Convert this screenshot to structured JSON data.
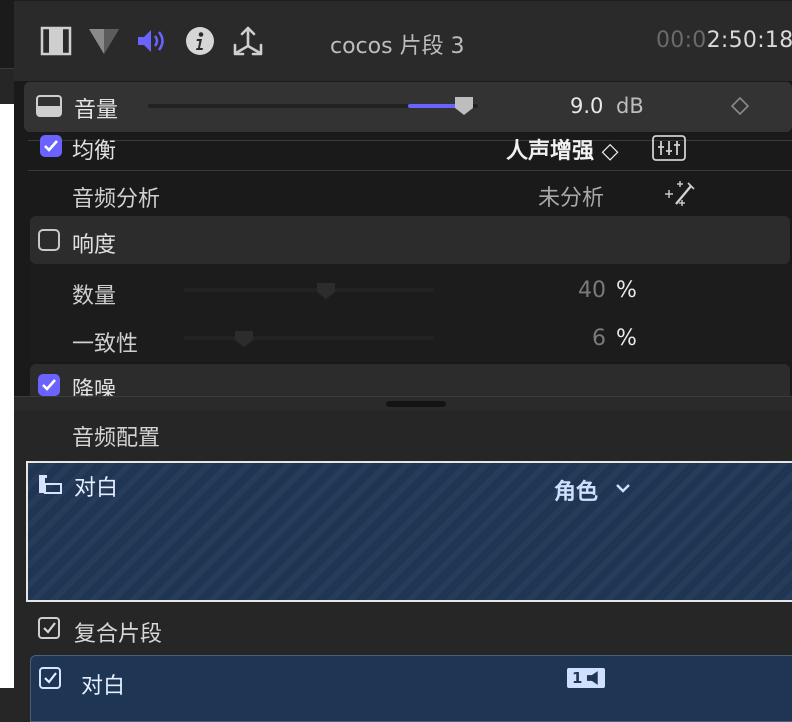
{
  "toolbar": {
    "icons": [
      "film-icon",
      "color-icon",
      "audio-icon",
      "info-icon",
      "share-icon"
    ],
    "clip_title": "cocos 片段 3",
    "timecode_dim": "00:0",
    "timecode_bright": "2:50:18"
  },
  "volume": {
    "label": "音量",
    "value": "9.0",
    "unit": "dB",
    "level_db": 9.0
  },
  "equalization": {
    "label": "均衡",
    "preset": "人声增强 ◇",
    "checked": true
  },
  "audio_analysis": {
    "label": "音频分析",
    "status": "未分析"
  },
  "loudness": {
    "label": "响度",
    "checked": false,
    "amount": {
      "label": "数量",
      "value": "40",
      "unit": "%"
    },
    "uniformity": {
      "label": "一致性",
      "value": "6",
      "unit": "%"
    }
  },
  "noise_reduction": {
    "label": "降噪",
    "checked": true
  },
  "audio_config": {
    "title": "音频配置",
    "role_component": {
      "label": "对白",
      "role_menu": "角色"
    },
    "compound_clip": {
      "label": "复合片段",
      "checked": true
    },
    "sub_component": {
      "label": "对白",
      "checked": true,
      "channel_badge": "1"
    }
  },
  "colors": {
    "accent": "#6b63ff",
    "selection_blue": "#1e3553"
  }
}
